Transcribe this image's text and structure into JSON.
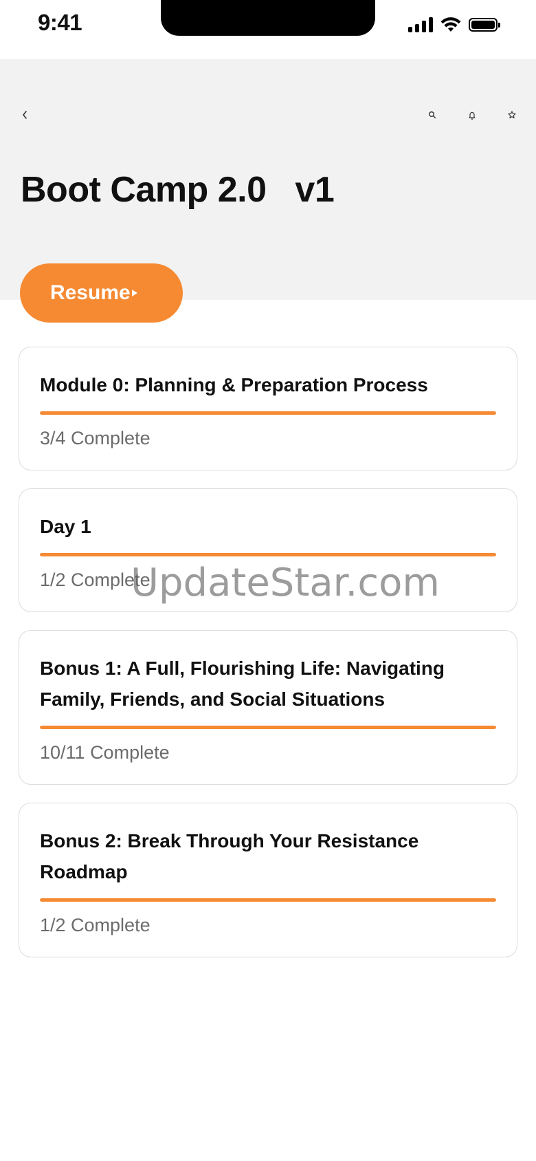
{
  "status_bar": {
    "time": "9:41"
  },
  "header": {
    "title": "Boot Camp 2.0   v1",
    "back_icon": "chevron-left-icon",
    "actions": [
      "search-icon",
      "bell-icon",
      "star-icon"
    ]
  },
  "resume": {
    "label": "Resume"
  },
  "modules": [
    {
      "title": "Module 0: Planning & Preparation Process",
      "status": "3/4 Complete",
      "progress": 1.0
    },
    {
      "title": "Day 1",
      "status": "1/2 Complete",
      "progress": 1.0
    },
    {
      "title": "Bonus 1: A Full, Flourishing Life: Navigating Family, Friends, and Social Situations",
      "status": "10/11 Complete",
      "progress": 1.0
    },
    {
      "title": "Bonus 2: Break Through Your Resistance Roadmap",
      "status": "1/2 Complete",
      "progress": 1.0
    }
  ],
  "watermark": "UpdateStar.com",
  "colors": {
    "accent": "#f68a32",
    "header_bg": "#f2f2f2",
    "muted_text": "#6b6b6b"
  }
}
